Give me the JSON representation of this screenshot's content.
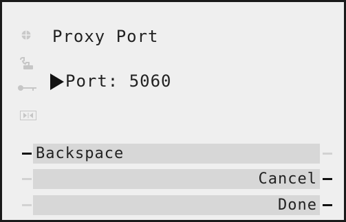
{
  "screen": {
    "title": "Proxy Port",
    "field_label": "Port:",
    "field_value": "5060"
  },
  "side_icons": [
    "globe-icon",
    "phone-icon",
    "key-icon",
    "transfer-icon"
  ],
  "softkeys": {
    "left": [
      {
        "label": "Backspace",
        "active": true
      },
      {
        "label": "",
        "active": false
      },
      {
        "label": "",
        "active": false
      }
    ],
    "right": [
      {
        "label": "",
        "active": false
      },
      {
        "label": "Cancel",
        "active": true
      },
      {
        "label": "Done",
        "active": true
      }
    ]
  }
}
